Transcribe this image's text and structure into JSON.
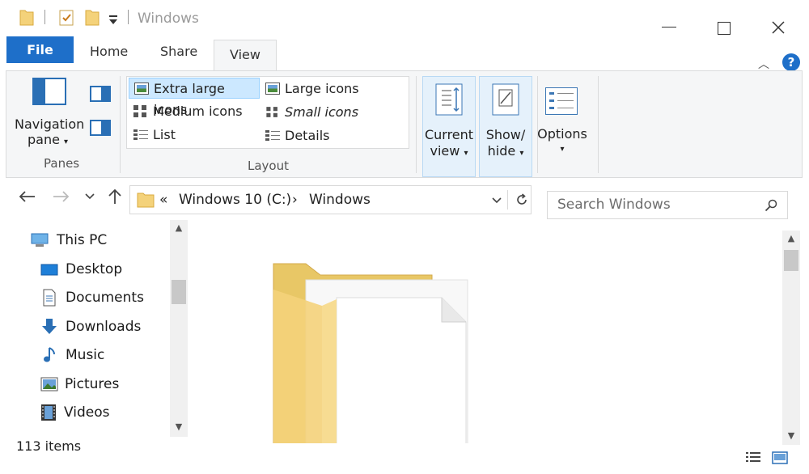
{
  "window": {
    "title": "Windows"
  },
  "tabs": {
    "file": "File",
    "home": "Home",
    "share": "Share",
    "view": "View",
    "help": "?"
  },
  "ribbon": {
    "panes": {
      "navigation_pane": "Navigation",
      "navigation_pane_2": "pane",
      "group_label": "Panes"
    },
    "layout": {
      "group_label": "Layout",
      "items": [
        {
          "label": "Extra large icons",
          "selected": true
        },
        {
          "label": "Large icons",
          "selected": false
        },
        {
          "label": "Medium icons",
          "selected": false
        },
        {
          "label": "Small icons",
          "selected": false
        },
        {
          "label": "List",
          "selected": false
        },
        {
          "label": "Details",
          "selected": false
        }
      ]
    },
    "current_view": {
      "line1": "Current",
      "line2": "view"
    },
    "show_hide": {
      "line1": "Show/",
      "line2": "hide"
    },
    "options": {
      "label": "Options"
    }
  },
  "address": {
    "overflow": "«",
    "crumbs": [
      "Windows 10 (C:)",
      "Windows"
    ],
    "separator": "›"
  },
  "search": {
    "placeholder": "Search Windows"
  },
  "nav_pane": {
    "items": [
      {
        "label": "This PC",
        "icon": "computer-icon"
      },
      {
        "label": "Desktop",
        "icon": "desktop-icon"
      },
      {
        "label": "Documents",
        "icon": "documents-icon"
      },
      {
        "label": "Downloads",
        "icon": "downloads-icon"
      },
      {
        "label": "Music",
        "icon": "music-icon"
      },
      {
        "label": "Pictures",
        "icon": "pictures-icon"
      },
      {
        "label": "Videos",
        "icon": "videos-icon"
      }
    ]
  },
  "status": {
    "item_count": "113 items"
  },
  "colors": {
    "accent": "#1e6fc9",
    "folder_yellow": "#f4d27a",
    "ribbon_bg": "#f5f6f7",
    "selection": "#cce8ff"
  }
}
